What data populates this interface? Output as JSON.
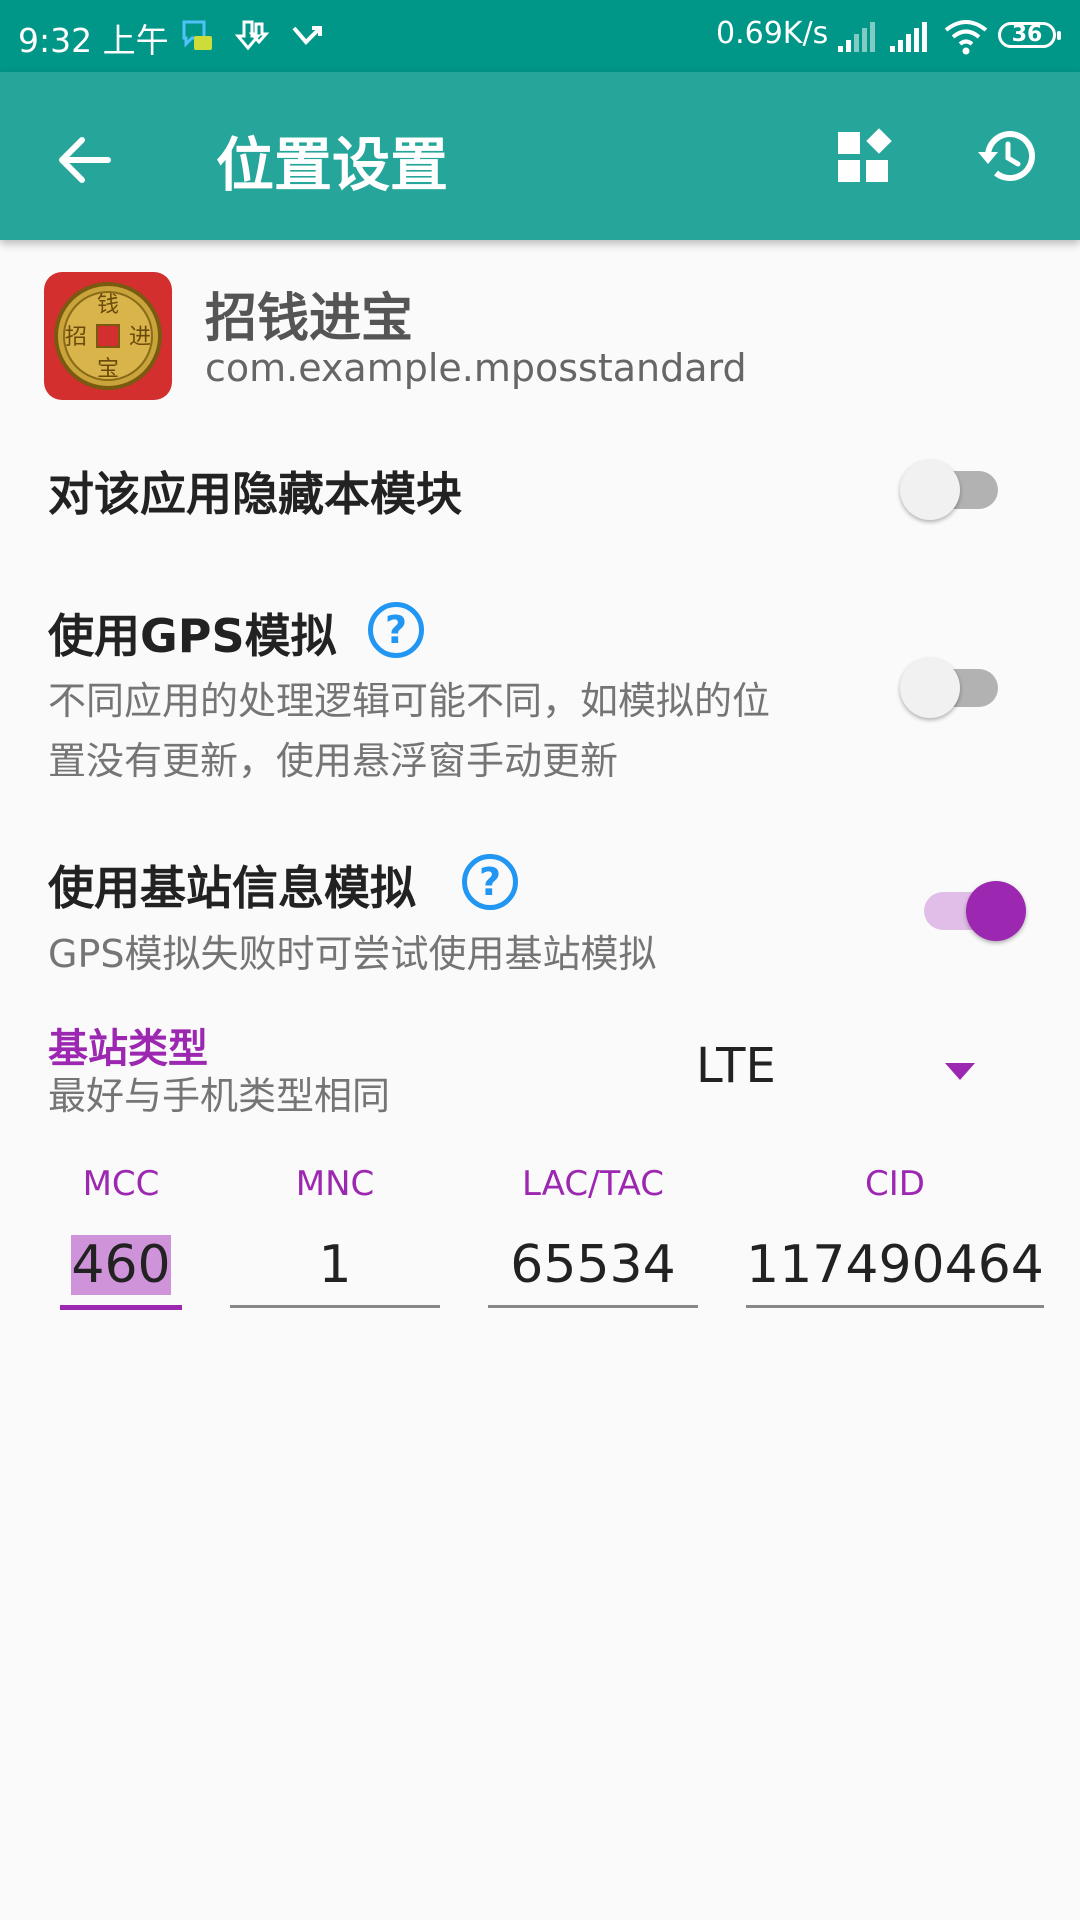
{
  "status_bar": {
    "time": "9:32 上午",
    "network_speed": "0.69K/s",
    "battery": "36",
    "icons": [
      "messaging-icon",
      "download-icon",
      "missed-call-icon",
      "signal-icon",
      "signal-icon",
      "wifi-icon",
      "battery-icon"
    ]
  },
  "toolbar": {
    "title": "位置设置",
    "icons": [
      "back-arrow-icon",
      "widgets-icon",
      "history-icon"
    ]
  },
  "app": {
    "name": "招钱进宝",
    "package": "com.example.mposstandard",
    "icon": "coin-icon",
    "icon_glyphs": [
      "钱",
      "进",
      "宝",
      "招"
    ]
  },
  "settings": {
    "hide_module": {
      "title": "对该应用隐藏本模块",
      "enabled": false
    },
    "gps_mock": {
      "title": "使用GPS模拟",
      "help": "?",
      "desc_line1": "不同应用的处理逻辑可能不同，如模拟的位",
      "desc_line2": "置没有更新，使用悬浮窗手动更新",
      "enabled": false
    },
    "cell_mock": {
      "title": "使用基站信息模拟",
      "help": "?",
      "desc": "GPS模拟失败时可尝试使用基站模拟",
      "enabled": true
    }
  },
  "cell_type": {
    "label": "基站类型",
    "hint": "最好与手机类型相同",
    "selected": "LTE"
  },
  "cell_fields": {
    "mcc": {
      "label": "MCC",
      "value": "460"
    },
    "mnc": {
      "label": "MNC",
      "value": "1"
    },
    "lac": {
      "label": "LAC/TAC",
      "value": "65534"
    },
    "cid": {
      "label": "CID",
      "value": "117490464"
    }
  },
  "colors": {
    "status_bar": "#009688",
    "app_bar": "#26a69a",
    "accent": "#9c27b0",
    "help": "#2196f3"
  }
}
